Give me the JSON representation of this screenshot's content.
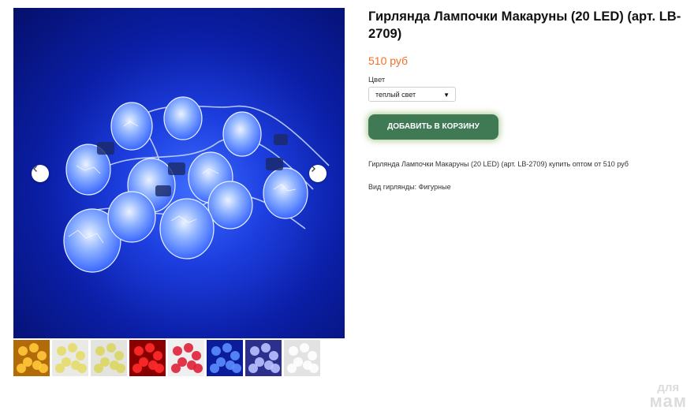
{
  "product": {
    "title": "Гирлянда Лампочки Макаруны (20 LED) (арт. LB-2709)",
    "price": "510 руб",
    "color_label": "Цвет",
    "color_selected": "теплый свет",
    "add_to_cart": "ДОБАВИТЬ В КОРЗИНУ",
    "description": "Гирлянда Лампочки Макаруны (20 LED) (арт. LB-2709) купить оптом от 510 руб",
    "spec_label": "Вид гирлянды:",
    "spec_value": "Фигурные"
  },
  "gallery": {
    "thumbnails": [
      {
        "bg": "#b36a08",
        "bulb": "#ffc83a"
      },
      {
        "bg": "#e9e9e6",
        "bulb": "#e6dc6a"
      },
      {
        "bg": "#e3e3df",
        "bulb": "#dcd660"
      },
      {
        "bg": "#8a0000",
        "bulb": "#ff2a2a"
      },
      {
        "bg": "#efefef",
        "bulb": "#e0203a"
      },
      {
        "bg": "#0a1c9a",
        "bulb": "#5a8cff"
      },
      {
        "bg": "#2d2f8c",
        "bulb": "#b9c2ff"
      },
      {
        "bg": "#e2e2e2",
        "bulb": "#ffffff"
      }
    ]
  },
  "watermark": {
    "line1": "для",
    "line2": "мам"
  }
}
